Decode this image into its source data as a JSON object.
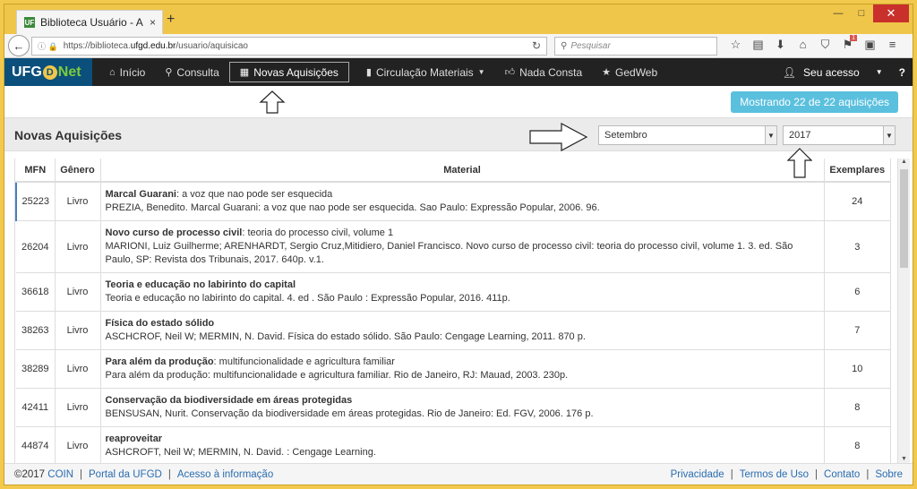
{
  "browser": {
    "tab_title": "Biblioteca Usuário - Aquisiç",
    "tab_favicon_text": "UF",
    "tab_close": "×",
    "new_tab": "+",
    "url_host": "https://biblioteca.",
    "url_domain": "ufgd.edu.br",
    "url_path": "/usuario/aquisicao",
    "search_placeholder": "Pesquisar",
    "notification_count": "1",
    "controls": {
      "minimize": "—",
      "maximize": "□",
      "close": "✕"
    }
  },
  "navbar": {
    "brand_pre": "UFG",
    "brand_o": "D",
    "brand_net": "Net",
    "items": [
      {
        "label": "Início",
        "icon": "home-icon"
      },
      {
        "label": "Consulta",
        "icon": "search-icon"
      },
      {
        "label": "Novas Aquisições",
        "icon": "grid-icon"
      },
      {
        "label": "Circulação Materiais",
        "icon": "book-icon"
      },
      {
        "label": "Nada Consta",
        "icon": "thumbs-up-icon"
      },
      {
        "label": "GedWeb",
        "icon": "star-icon"
      }
    ],
    "account": "Seu acesso",
    "help": "?"
  },
  "page": {
    "showing": "Mostrando 22 de 22 aquisições",
    "title": "Novas Aquisições",
    "month": "Setembro",
    "year": "2017"
  },
  "table": {
    "headers": {
      "mfn": "MFN",
      "genre": "Gênero",
      "material": "Material",
      "copies": "Exemplares"
    },
    "rows": [
      {
        "mfn": "25223",
        "genre": "Livro",
        "title": "Marcal Guarani",
        "subtitle": ": a voz que nao pode ser esquecida",
        "ref": "PREZIA, Benedito. Marcal Guarani: a voz que nao pode ser esquecida. Sao Paulo: Expressão Popular, 2006. 96.",
        "copies": "24"
      },
      {
        "mfn": "26204",
        "genre": "Livro",
        "title": "Novo curso de processo civil",
        "subtitle": ": teoria do processo civil, volume 1",
        "ref": "MARIONI, Luiz Guilherme; ARENHARDT, Sergio Cruz,Mitidiero, Daniel Francisco. Novo curso de processo civil: teoria do processo civil, volume 1. 3. ed. São Paulo, SP: Revista dos Tribunais, 2017. 640p. v.1.",
        "copies": "3"
      },
      {
        "mfn": "36618",
        "genre": "Livro",
        "title": "Teoria e educação no labirinto do capital",
        "subtitle": "",
        "ref": "Teoria e educação no labirinto do capital. 4. ed . São Paulo : Expressão Popular, 2016. 411p.",
        "copies": "6"
      },
      {
        "mfn": "38263",
        "genre": "Livro",
        "title": "Física do estado sólido",
        "subtitle": "",
        "ref": "ASCHCROF, Neil W; MERMIN, N. David. Física do estado sólido. São Paulo: Cengage Learning, 2011. 870 p.",
        "copies": "7"
      },
      {
        "mfn": "38289",
        "genre": "Livro",
        "title": "Para além da produção",
        "subtitle": ": multifuncionalidade e agricultura familiar",
        "ref": "Para além da produção: multifuncionalidade e agricultura familiar. Rio de Janeiro, RJ: Mauad, 2003. 230p.",
        "copies": "10"
      },
      {
        "mfn": "42411",
        "genre": "Livro",
        "title": "Conservação da biodiversidade em áreas protegidas",
        "subtitle": "",
        "ref": "BENSUSAN, Nurit. Conservação da biodiversidade em áreas protegidas. Rio de Janeiro: Ed. FGV, 2006. 176 p.",
        "copies": "8"
      },
      {
        "mfn": "44874",
        "genre": "Livro",
        "title": "reaproveitar",
        "subtitle": "",
        "ref": "ASHCROFT, Neil W; MERMIN, N. David. : Cengage Learning.",
        "copies": "8"
      }
    ]
  },
  "footer": {
    "copyright": "©2017",
    "coin": "COIN",
    "portal": "Portal da UFGD",
    "access": "Acesso à informação",
    "privacy": "Privacidade",
    "terms": "Termos de Uso",
    "contact": "Contato",
    "about": "Sobre"
  }
}
